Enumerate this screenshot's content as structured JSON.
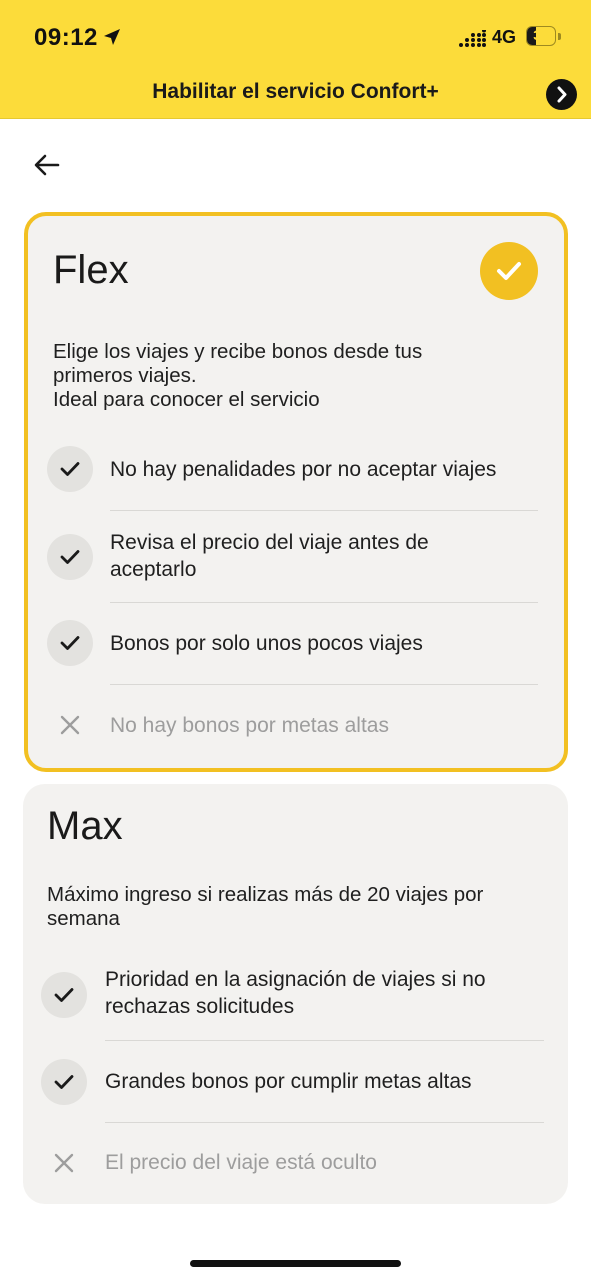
{
  "status_bar": {
    "time": "09:12",
    "network": "4G",
    "battery_level": "32"
  },
  "banner": {
    "title": "Habilitar el servicio Confort+",
    "arrow_icon": "chevron-right-icon"
  },
  "nav": {
    "back_icon": "arrow-left-icon"
  },
  "colors": {
    "banner_bg": "#fcdc3a",
    "accent": "#f2c022",
    "card_bg": "#f3f2f0",
    "muted_text": "#9d9d9d"
  },
  "plans": [
    {
      "title": "Flex",
      "selected": true,
      "description_lines": [
        "Elige los viajes y recibe bonos desde tus",
        "primeros viajes.",
        "Ideal para conocer el servicio"
      ],
      "features": [
        {
          "lines": [
            "No hay penalidades por no aceptar viajes"
          ],
          "included": true
        },
        {
          "lines": [
            "Revisa el precio del viaje antes de",
            "aceptarlo"
          ],
          "included": true
        },
        {
          "lines": [
            "Bonos por solo unos pocos viajes"
          ],
          "included": true
        },
        {
          "lines": [
            "No hay bonos por metas altas"
          ],
          "included": false
        }
      ]
    },
    {
      "title": "Max",
      "selected": false,
      "description_lines": [
        "Máximo ingreso si realizas más de 20 viajes por",
        "semana"
      ],
      "features": [
        {
          "lines": [
            "Prioridad en la asignación de viajes si no",
            "rechazas solicitudes"
          ],
          "included": true
        },
        {
          "lines": [
            "Grandes bonos por cumplir metas altas"
          ],
          "included": true
        },
        {
          "lines": [
            "El precio del viaje está oculto"
          ],
          "included": false
        }
      ]
    }
  ]
}
